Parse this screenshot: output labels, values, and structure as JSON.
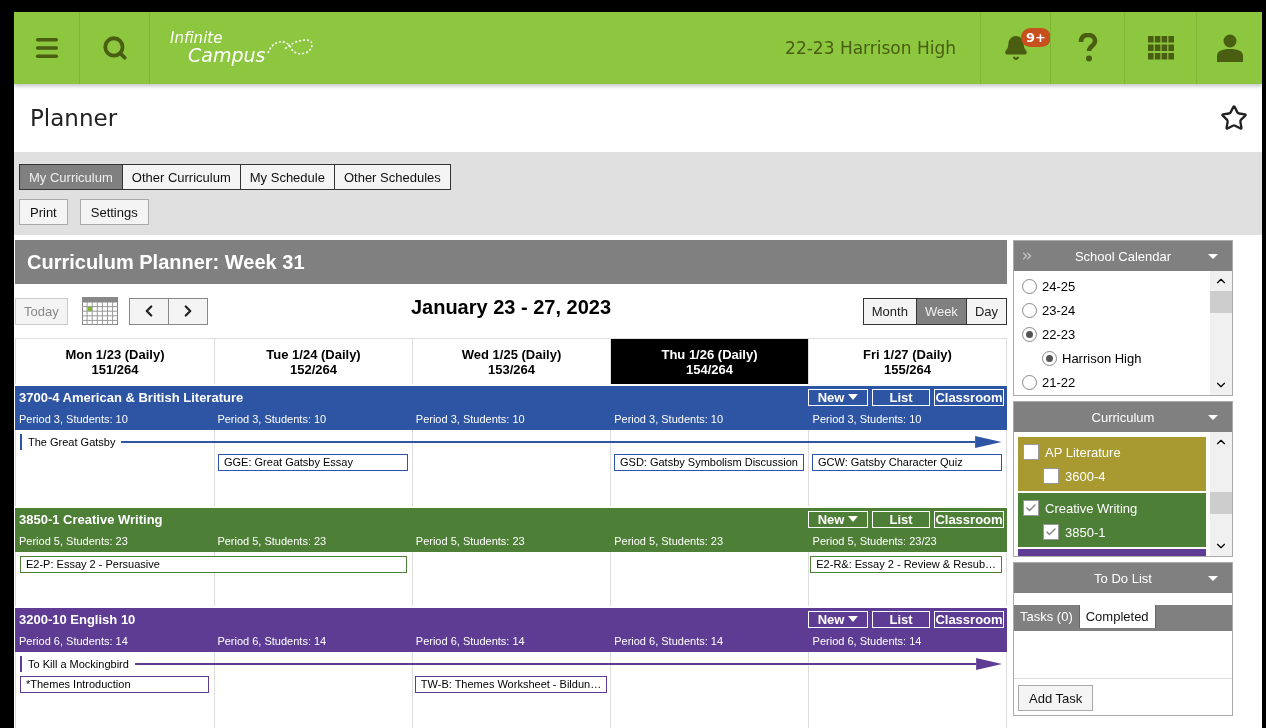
{
  "header": {
    "logo": {
      "line1": "Infinite",
      "line2": "Campus"
    },
    "context": "22-23 Harrison High",
    "notification_badge": "9+"
  },
  "page": {
    "title": "Planner",
    "favorite": false
  },
  "tabs": [
    {
      "label": "My Curriculum",
      "selected": true
    },
    {
      "label": "Other Curriculum",
      "selected": false
    },
    {
      "label": "My Schedule",
      "selected": false
    },
    {
      "label": "Other Schedules",
      "selected": false
    }
  ],
  "actions": [
    "Print",
    "Settings"
  ],
  "planner": {
    "title": "Curriculum Planner: Week 31",
    "today": "Today",
    "today_disabled": true,
    "range": "January 23 - 27, 2023",
    "views": [
      {
        "label": "Month",
        "selected": false
      },
      {
        "label": "Week",
        "selected": true
      },
      {
        "label": "Day",
        "selected": false
      }
    ],
    "days": [
      {
        "label": "Mon 1/23 (Daily)",
        "count": "151/264",
        "selected": false
      },
      {
        "label": "Tue 1/24 (Daily)",
        "count": "152/264",
        "selected": false
      },
      {
        "label": "Wed 1/25 (Daily)",
        "count": "153/264",
        "selected": false
      },
      {
        "label": "Thu 1/26 (Daily)",
        "count": "154/264",
        "selected": true
      },
      {
        "label": "Fri 1/27 (Daily)",
        "count": "155/264",
        "selected": false
      }
    ],
    "courses": [
      {
        "title": "3700-4 American & British Literature",
        "color": "#2e54a4",
        "buttons": {
          "new": "New",
          "list": "List",
          "classroom": "Classroom"
        },
        "unit": "The Great Gatsby",
        "days": [
          {
            "period": "Period 3, Students: 10"
          },
          {
            "period": "Period 3, Students: 10",
            "lessons": [
              {
                "title": "GGE: Great Gatsby Essay",
                "continues_next_day": false
              }
            ]
          },
          {
            "period": "Period 3, Students: 10"
          },
          {
            "period": "Period 3, Students: 10",
            "lessons": [
              {
                "title": "GSD: Gatsby Symbolism Discussion",
                "continues_next_day": false
              }
            ]
          },
          {
            "period": "Period 3, Students: 10",
            "lessons": [
              {
                "title": "GCW: Gatsby Character Quiz",
                "continues_next_day": false
              }
            ]
          }
        ]
      },
      {
        "title": "3850-1 Creative Writing",
        "color": "#4e7f37",
        "buttons": {
          "new": "New",
          "list": "List",
          "classroom": "Classroom"
        },
        "days": [
          {
            "period": "Period 5, Students: 23",
            "lessons": [
              {
                "title": "E2-P: Essay 2 - Persuasive",
                "continues_next_day": true
              }
            ]
          },
          {
            "period": "Period 5, Students: 23"
          },
          {
            "period": "Period 5, Students: 23"
          },
          {
            "period": "Period 5, Students: 23"
          },
          {
            "period": "Period 5, Students: 23/23",
            "lessons": [
              {
                "title": "E2-R&: Essay 2 - Review & Resub…",
                "continues_next_day": false
              }
            ]
          }
        ]
      },
      {
        "title": "3200-10 English 10",
        "color": "#5e3c94",
        "buttons": {
          "new": "New",
          "list": "List",
          "classroom": "Classroom"
        },
        "unit": "To Kill a Mockingbird",
        "days": [
          {
            "period": "Period 6, Students: 14",
            "lessons": [
              {
                "title": "*Themes Introduction",
                "continues_next_day": false
              }
            ]
          },
          {
            "period": "Period 6, Students: 14"
          },
          {
            "period": "Period 6, Students: 14",
            "lessons": [
              {
                "title": "TW-B: Themes Worksheet - Bildun…",
                "continues_next_day": false
              }
            ]
          },
          {
            "period": "Period 6, Students: 14"
          },
          {
            "period": "Period 6, Students: 14"
          }
        ]
      }
    ]
  },
  "school_calendar": {
    "title": "School Calendar",
    "items": [
      {
        "label": "24-25",
        "selected": false
      },
      {
        "label": "23-24",
        "selected": false
      },
      {
        "label": "22-23",
        "selected": true,
        "children": [
          {
            "label": "Harrison High",
            "selected": true
          }
        ]
      },
      {
        "label": "21-22",
        "selected": false
      }
    ]
  },
  "curriculum": {
    "title": "Curriculum",
    "items": [
      {
        "label": "AP Literature",
        "checked": false,
        "color": "#a89a30",
        "children": [
          {
            "label": "3600-4",
            "checked": false
          }
        ]
      },
      {
        "label": "Creative Writing",
        "checked": true,
        "color": "#4e7f37",
        "children": [
          {
            "label": "3850-1",
            "checked": true
          }
        ]
      },
      {
        "color": "#5e3c94"
      }
    ]
  },
  "todo": {
    "title": "To Do List",
    "tabs": [
      {
        "label": "Tasks (0)",
        "selected": false
      },
      {
        "label": "Completed",
        "selected": true
      }
    ],
    "add_button": "Add Task"
  }
}
